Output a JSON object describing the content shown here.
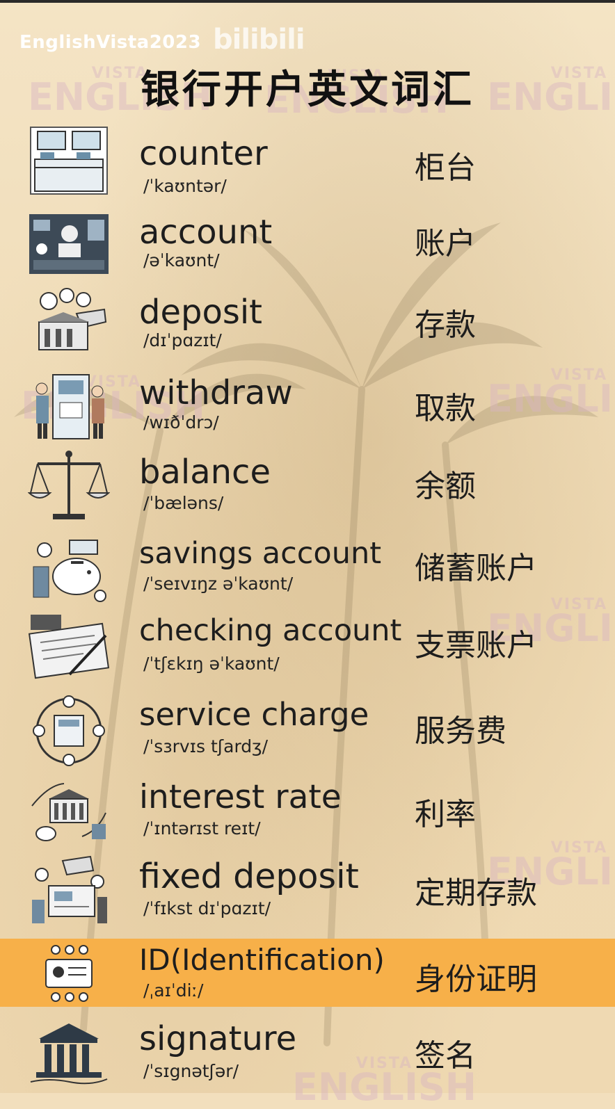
{
  "header": {
    "brand": "EnglishVista2023",
    "logo": "bilibili",
    "title": "银行开户英文词汇"
  },
  "watermark": {
    "small": "VISTA",
    "big": "ENGLISH"
  },
  "colors": {
    "background": "#f2dfbd",
    "highlight": "#f7b049",
    "text": "#1d1d1d"
  },
  "vocab": [
    {
      "icon": "bank-counter-icon",
      "word": "counter",
      "ipa": "/ˈkaʊntər/",
      "zh": "柜台"
    },
    {
      "icon": "account-dashboard-icon",
      "word": "account",
      "ipa": "/əˈkaʊnt/",
      "zh": "账户"
    },
    {
      "icon": "deposit-icon",
      "word": "deposit",
      "ipa": "/dɪˈpɑzɪt/",
      "zh": "存款"
    },
    {
      "icon": "atm-withdraw-icon",
      "word": "withdraw",
      "ipa": "/wɪðˈdrɔ/",
      "zh": "取款"
    },
    {
      "icon": "balance-scale-icon",
      "word": "balance",
      "ipa": "/ˈbæləns/",
      "zh": "余额"
    },
    {
      "icon": "piggy-bank-icon",
      "word": "savings account",
      "ipa": "/ˈseɪvɪŋz əˈkaʊnt/",
      "zh": "储蓄账户"
    },
    {
      "icon": "checkbook-icon",
      "word": "checking account",
      "ipa": "/ˈtʃɛkɪŋ əˈkaʊnt/",
      "zh": "支票账户"
    },
    {
      "icon": "service-charge-icon",
      "word": "service charge",
      "ipa": "/ˈsɜrvɪs tʃardʒ/",
      "zh": "服务费"
    },
    {
      "icon": "interest-rate-icon",
      "word": "interest rate",
      "ipa": "/ˈɪntərɪst reɪt/",
      "zh": "利率"
    },
    {
      "icon": "fixed-deposit-icon",
      "word": "fixed deposit",
      "ipa": "/ˈfɪkst dɪˈpɑzɪt/",
      "zh": "定期存款"
    },
    {
      "icon": "id-card-icon",
      "word": "ID(Identification)",
      "ipa": "/ˌaɪˈdiː/",
      "zh": "身份证明",
      "highlighted": true
    },
    {
      "icon": "bank-building-icon",
      "word": "signature",
      "ipa": "/ˈsɪgnətʃər/",
      "zh": "签名"
    }
  ]
}
